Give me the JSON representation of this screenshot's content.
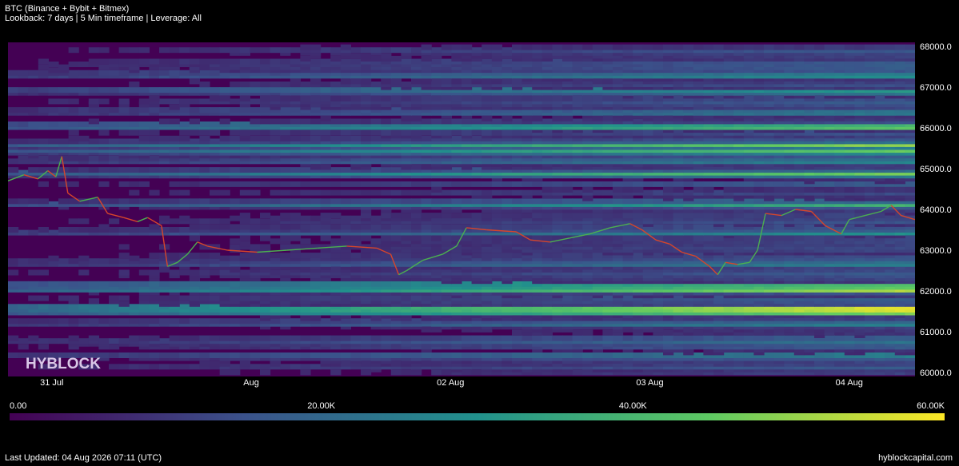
{
  "header": {
    "title": "BTC (Binance + Bybit + Bitmex)",
    "subtitle": "Lookback: 7 days | 5 Min timeframe | Leverage: All"
  },
  "watermark": "HYBLOCK",
  "footer": {
    "last_updated": "Last Updated: 04 Aug 2026 07:11 (UTC)",
    "site": "hyblockcapital.com"
  },
  "chart_data": {
    "type": "heatmap",
    "title": "BTC (Binance + Bybit + Bitmex)",
    "y_axis": {
      "range": [
        59900,
        68100
      ],
      "ticks": [
        "68000.0",
        "67000.0",
        "66000.0",
        "65000.0",
        "64000.0",
        "63000.0",
        "62000.0",
        "61000.0",
        "60000.0"
      ],
      "tick_values": [
        68000,
        67000,
        66000,
        65000,
        64000,
        63000,
        62000,
        61000,
        60000
      ]
    },
    "x_axis": {
      "range_days": [
        0,
        4.55
      ],
      "ticks": [
        "31 Jul",
        "Aug",
        "02 Aug",
        "03 Aug",
        "04 Aug"
      ],
      "tick_days": [
        0.22,
        1.22,
        2.22,
        3.22,
        4.22
      ]
    },
    "colorbar": {
      "range": [
        0,
        60000
      ],
      "tick_labels": [
        "0.00",
        "20.00K",
        "40.00K",
        "60.00K"
      ],
      "tick_values": [
        0,
        20000,
        40000,
        60000
      ],
      "colors": [
        "#440154",
        "#3b528b",
        "#21918c",
        "#5ec962",
        "#fde725"
      ]
    },
    "price_series": {
      "name": "BTC price",
      "colors": [
        "#d6452b",
        "#4caf50"
      ],
      "points": [
        [
          0.0,
          64700
        ],
        [
          0.08,
          64850
        ],
        [
          0.15,
          64750
        ],
        [
          0.2,
          64950
        ],
        [
          0.24,
          64800
        ],
        [
          0.27,
          65300
        ],
        [
          0.3,
          64400
        ],
        [
          0.36,
          64200
        ],
        [
          0.45,
          64300
        ],
        [
          0.5,
          63900
        ],
        [
          0.58,
          63800
        ],
        [
          0.65,
          63700
        ],
        [
          0.7,
          63800
        ],
        [
          0.77,
          63600
        ],
        [
          0.8,
          62600
        ],
        [
          0.85,
          62700
        ],
        [
          0.9,
          62900
        ],
        [
          0.95,
          63200
        ],
        [
          1.0,
          63100
        ],
        [
          1.1,
          63000
        ],
        [
          1.25,
          62950
        ],
        [
          1.4,
          63000
        ],
        [
          1.55,
          63050
        ],
        [
          1.7,
          63100
        ],
        [
          1.85,
          63050
        ],
        [
          1.92,
          62900
        ],
        [
          1.96,
          62400
        ],
        [
          2.0,
          62500
        ],
        [
          2.08,
          62750
        ],
        [
          2.18,
          62900
        ],
        [
          2.25,
          63100
        ],
        [
          2.3,
          63550
        ],
        [
          2.4,
          63500
        ],
        [
          2.55,
          63450
        ],
        [
          2.62,
          63250
        ],
        [
          2.72,
          63200
        ],
        [
          2.82,
          63300
        ],
        [
          2.92,
          63400
        ],
        [
          3.02,
          63550
        ],
        [
          3.12,
          63650
        ],
        [
          3.18,
          63500
        ],
        [
          3.25,
          63250
        ],
        [
          3.32,
          63150
        ],
        [
          3.38,
          62950
        ],
        [
          3.45,
          62850
        ],
        [
          3.52,
          62600
        ],
        [
          3.56,
          62400
        ],
        [
          3.6,
          62700
        ],
        [
          3.66,
          62650
        ],
        [
          3.72,
          62700
        ],
        [
          3.76,
          63000
        ],
        [
          3.8,
          63900
        ],
        [
          3.88,
          63850
        ],
        [
          3.95,
          64000
        ],
        [
          4.03,
          63950
        ],
        [
          4.1,
          63600
        ],
        [
          4.18,
          63400
        ],
        [
          4.22,
          63750
        ],
        [
          4.3,
          63850
        ],
        [
          4.38,
          63950
        ],
        [
          4.43,
          64100
        ],
        [
          4.48,
          63850
        ],
        [
          4.55,
          63750
        ]
      ]
    }
  }
}
